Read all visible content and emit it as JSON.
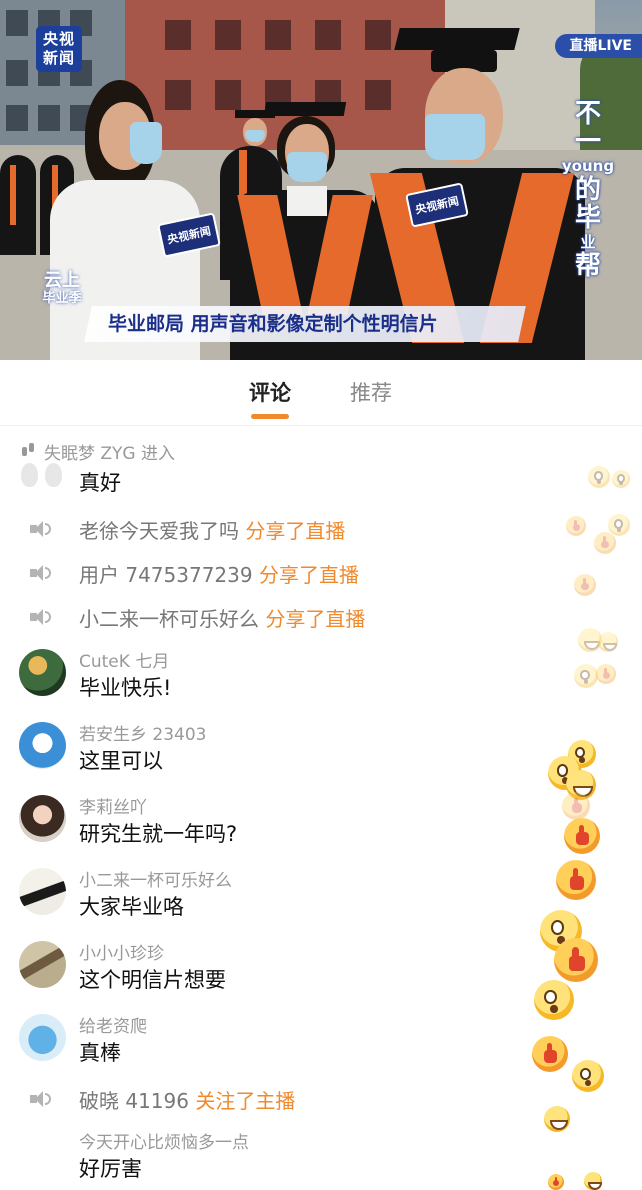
{
  "video": {
    "channel_logo": "央视\n新闻",
    "live_tag": "直播LIVE",
    "side_title": {
      "line1": "不",
      "line2": "一",
      "line3": "young",
      "line4": "的",
      "line5": "毕",
      "line6": "业",
      "line7": "帮"
    },
    "season_logo": "云上\n毕业季",
    "banner": "毕业邮局  用声音和影像定制个性明信片",
    "mic_labels": [
      "央视新闻",
      "央视新闻"
    ]
  },
  "tabs": [
    {
      "label": "评论",
      "active": true
    },
    {
      "label": "推荐",
      "active": false
    }
  ],
  "colors": {
    "accent": "#f08a2c",
    "brand_blue": "#1b3f9a"
  },
  "feed": {
    "enter_notice": {
      "user": "失眠梦 ZYG",
      "action": "进入"
    },
    "items": [
      {
        "kind": "comment",
        "avatar": "footprints",
        "user": "",
        "text": "真好"
      },
      {
        "kind": "share",
        "user": "老徐今天爱我了吗",
        "action": "分享了直播"
      },
      {
        "kind": "share",
        "user": "用户 7475377239",
        "action": "分享了直播"
      },
      {
        "kind": "share",
        "user": "小二来一杯可乐好么",
        "action": "分享了直播"
      },
      {
        "kind": "comment",
        "avatar": "landscape",
        "user": "CuteK 七月",
        "text": "毕业快乐!"
      },
      {
        "kind": "comment",
        "avatar": "doraemon",
        "user": "若安生乡 23403",
        "text": "这里可以"
      },
      {
        "kind": "comment",
        "avatar": "girl-portrait",
        "user": "李莉丝吖",
        "text": "研究生就一年吗?"
      },
      {
        "kind": "comment",
        "avatar": "calligraphy",
        "user": "小二来一杯可乐好么",
        "text": "大家毕业咯"
      },
      {
        "kind": "comment",
        "avatar": "sketch",
        "user": "小小小珍珍",
        "text": "这个明信片想要"
      },
      {
        "kind": "comment",
        "avatar": "cartoon-creature",
        "user": "给老资爬",
        "text": "真棒"
      },
      {
        "kind": "follow",
        "user": "破晓 41196",
        "action": "关注了主播"
      },
      {
        "kind": "comment",
        "avatar": "none",
        "user": "今天开心比烦恼多一点",
        "text": "好厉害"
      }
    ]
  },
  "reactions": [
    "wow-emoji",
    "thumb-emoji",
    "grin-emoji"
  ]
}
